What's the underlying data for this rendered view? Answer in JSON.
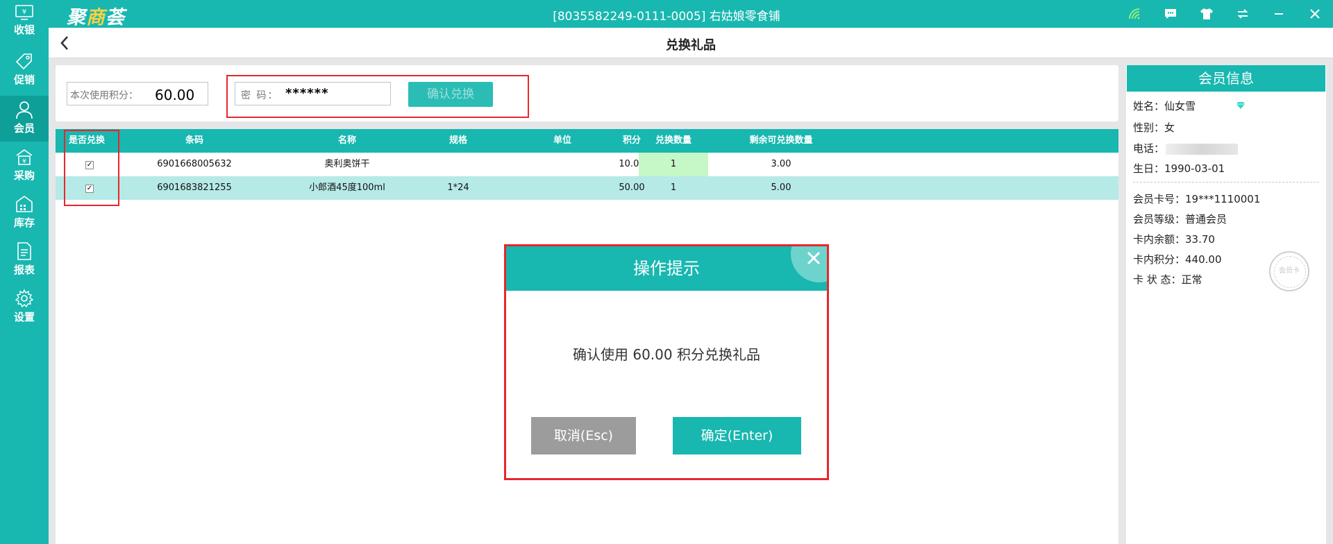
{
  "app": {
    "logo_part1": "聚",
    "logo_part2": "商",
    "logo_part3": "荟",
    "store_title": "[8035582249-0111-0005] 右姑娘零食铺"
  },
  "sidebar": {
    "items": [
      {
        "label": "收银",
        "icon": "cashier-icon"
      },
      {
        "label": "促销",
        "icon": "tag-icon"
      },
      {
        "label": "会员",
        "icon": "user-icon",
        "active": true
      },
      {
        "label": "采购",
        "icon": "purchase-icon"
      },
      {
        "label": "库存",
        "icon": "warehouse-icon"
      },
      {
        "label": "报表",
        "icon": "report-icon"
      },
      {
        "label": "设置",
        "icon": "gear-icon"
      }
    ]
  },
  "topbar_icons": [
    "wifi-icon",
    "chat-icon",
    "shirt-icon",
    "swap-icon",
    "minimize-icon",
    "close-icon"
  ],
  "page": {
    "title": "兑换礼品"
  },
  "toolbar": {
    "points_label": "本次使用积分：",
    "points_value": "60.00",
    "password_label": "密  码：",
    "password_value": "******",
    "confirm_label": "确认兑换"
  },
  "table": {
    "headers": [
      "是否兑换",
      "条码",
      "名称",
      "规格",
      "单位",
      "积分",
      "兑换数量",
      "剩余可兑换数量"
    ],
    "rows": [
      {
        "checked": "✓",
        "barcode": "6901668005632",
        "name": "奥利奥饼干",
        "spec": "",
        "unit": "",
        "points": "10.00",
        "qty": "1",
        "remaining": "3.00"
      },
      {
        "checked": "✓",
        "barcode": "6901683821255",
        "name": "小郎酒45度100ml",
        "spec": "1*24",
        "unit": "",
        "points": "50.00",
        "qty": "1",
        "remaining": "5.00"
      }
    ]
  },
  "member": {
    "title": "会员信息",
    "name": "姓名：仙女雪",
    "gender": "性别：女",
    "phone_label": "电话：",
    "birthday": "生日：1990-03-01",
    "card_no": "会员卡号：19***1110001",
    "level": "会员等级：普通会员",
    "balance": "卡内余额：33.70",
    "points": "卡内积分：440.00",
    "status": "卡 状 态：正常",
    "stamp": "会员卡"
  },
  "modal": {
    "title": "操作提示",
    "message": "确认使用 60.00 积分兑换礼品",
    "cancel": "取消(Esc)",
    "ok": "确定(Enter)"
  },
  "colors": {
    "primary": "#18b7b0",
    "highlight_red": "#e8262b",
    "qty_highlight": "#c6f7c7",
    "row_alt": "#b6eae7"
  }
}
